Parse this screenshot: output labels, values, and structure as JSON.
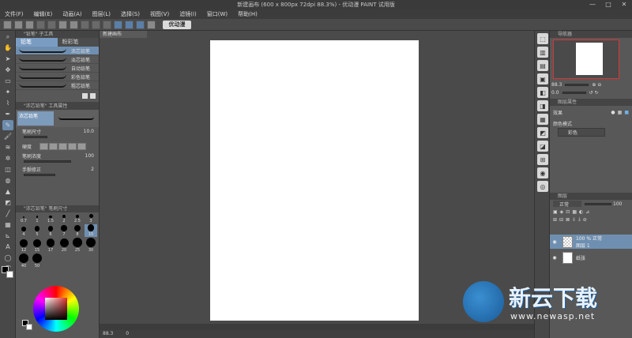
{
  "window": {
    "title": "新建画布 (600 x 800px 72dpi 88.3%) - 优动漫 PAINT 试用版",
    "minimize": "—",
    "maximize": "□",
    "close": "✕"
  },
  "menu": [
    "文件(F)",
    "编辑(E)",
    "动画(A)",
    "图层(L)",
    "选择(S)",
    "视图(V)",
    "滤镜(I)",
    "窗口(W)",
    "帮助(H)"
  ],
  "toolbar": {
    "logo_text": "优动漫"
  },
  "subtool": {
    "panel_header": "\"铅笔\" 子工具",
    "tabs": [
      "铅笔",
      "粉彩笔"
    ],
    "brushes": [
      "浓芯铅笔",
      "淡芯铅笔",
      "自动铅笔",
      "彩色铅笔",
      "粗芯铅笔"
    ]
  },
  "tool_property": {
    "header": "\"浓芯铅笔\" 工具属性",
    "brush_name": "浓芯铅笔",
    "brush_size_label": "笔刷尺寸",
    "brush_size_value": "10.0",
    "hardness_label": "硬度",
    "density_label": "笔刷浓度",
    "density_value": "100",
    "stabilization_label": "手颤修正",
    "stabilization_value": "2"
  },
  "brush_size_panel": {
    "header": "\"浓芯铅笔\" 笔刷尺寸",
    "sizes": [
      "0.7",
      "1",
      "1.5",
      "2",
      "2.5",
      "3",
      "4",
      "5",
      "6",
      "7",
      "8",
      "10",
      "12",
      "15",
      "17",
      "20",
      "25",
      "30",
      "40",
      "50"
    ]
  },
  "document": {
    "tab_label": "新建画布"
  },
  "status": {
    "zoom": "88.3",
    "bottom_label": "0"
  },
  "navigator": {
    "header": "导航器",
    "zoom_value": "88.3",
    "angle_value": "0.0"
  },
  "layer_property": {
    "header": "图层属性",
    "effect_label": "效果",
    "color_mode_label": "颜色模式",
    "color_mode_value": "彩色"
  },
  "layers": {
    "header": "图层",
    "blend_mode": "正常",
    "opacity_value": "100",
    "items": [
      {
        "line1": "100 % 正常",
        "line2": "图层 1"
      },
      {
        "line1": "",
        "line2": "纸张"
      }
    ]
  },
  "colors": {
    "accent": "#6f8fb0",
    "nav_border": "#dd3333"
  },
  "watermark": {
    "brand_text": "新云下载",
    "url": "www.newasp.net"
  }
}
